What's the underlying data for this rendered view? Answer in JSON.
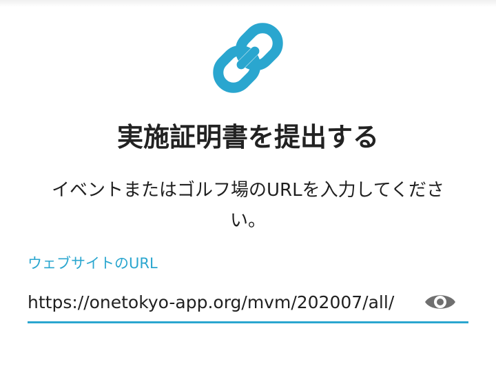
{
  "header": {
    "icon": "link-icon",
    "title": "実施証明書を提出する"
  },
  "description": {
    "line1": "イベントまたはゴルフ場のURLを入力してくださ",
    "line2": "い。"
  },
  "website_field": {
    "label": "ウェブサイトのURL",
    "value": "https://onetokyo-app.org/mvm/202007/all/",
    "toggle_icon": "eye-icon"
  },
  "colors": {
    "accent": "#2aa6cf",
    "icon_gray": "#6f6f6f",
    "text": "#1f1f1f"
  }
}
